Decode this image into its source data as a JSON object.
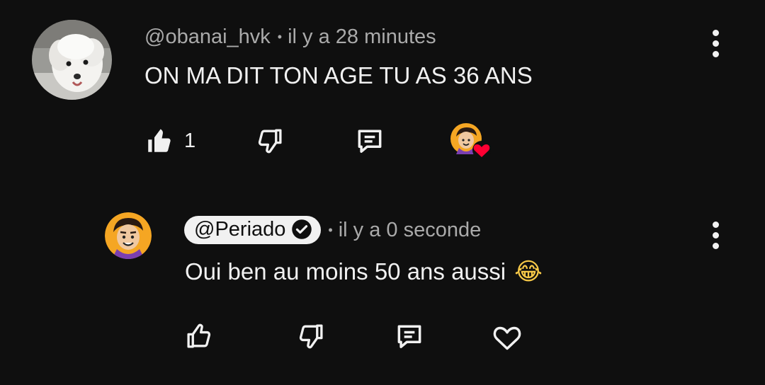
{
  "comment": {
    "author": "@obanai_hvk",
    "time": "il y a 28 minutes",
    "text": "ON MA DIT TON AGE TU AS 36 ANS",
    "like_count": "1"
  },
  "reply": {
    "author": "@Periado",
    "time": "il y a 0 seconde",
    "text": "Oui ben au moins 50 ans aussi",
    "emoji": "😂"
  },
  "separator": "•",
  "icons": {
    "like_filled": "thumb-up-filled-icon",
    "like": "thumb-up-icon",
    "dislike": "thumb-down-icon",
    "reply": "comment-reply-icon",
    "heart": "heart-icon",
    "more": "more-vertical-icon",
    "verified": "verified-check-icon"
  },
  "colors": {
    "background": "#0f0f0f",
    "primary_text": "#f1f1f1",
    "secondary_text": "#aaaaaa",
    "heart_red": "#ff0033",
    "avatar_orange": "#f5a623"
  }
}
